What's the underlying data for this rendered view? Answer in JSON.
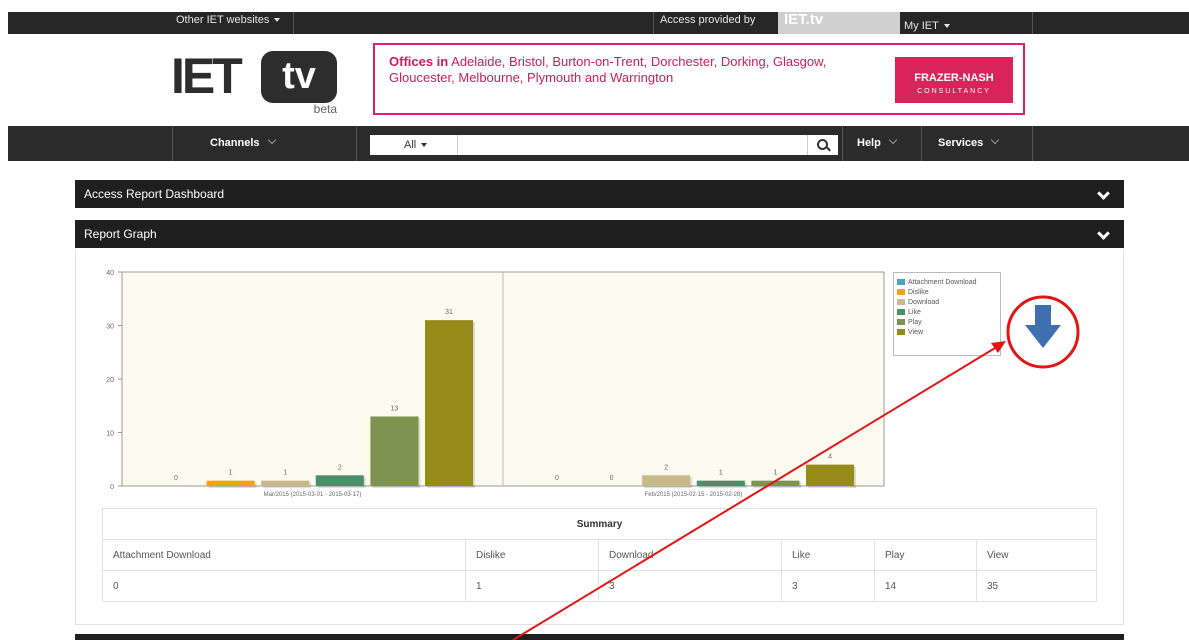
{
  "topbar": {
    "other_sites_label": "Other IET websites",
    "access_provided_label": "Access provided by",
    "access_logo_text": "IET.tv",
    "my_iet_label": "My IET"
  },
  "logo": {
    "text": "IET",
    "tv_text": "tv",
    "badge": "beta"
  },
  "ad": {
    "offices_lead": "Offices in",
    "offices_text": "Adelaide, Bristol, Burton-on-Trent, Dorchester, Dorking, Glasgow, Gloucester, Melbourne, Plymouth and Warrington",
    "brand_name": "FRAZER-NASH",
    "brand_sub": "CONSULTANCY"
  },
  "nav": {
    "channels_label": "Channels",
    "search_scope": "All",
    "search_value": "",
    "help_label": "Help",
    "services_label": "Services"
  },
  "panels": {
    "access_report": "Access Report Dashboard",
    "report_graph": "Report Graph"
  },
  "chart_data": {
    "type": "bar",
    "categories": [
      "Mar/2015 (2015-03-01 - 2015-03-17)",
      "Feb/2015 (2015-02-15 - 2015-02-28)"
    ],
    "series": [
      {
        "name": "Attachment Download",
        "color": "#4aa3c9",
        "values": [
          0,
          0
        ]
      },
      {
        "name": "Dislike",
        "color": "#f2a11a",
        "values": [
          1,
          0
        ]
      },
      {
        "name": "Download",
        "color": "#c8b98a",
        "values": [
          1,
          2
        ]
      },
      {
        "name": "Like",
        "color": "#4a8f6a",
        "values": [
          2,
          1
        ]
      },
      {
        "name": "Play",
        "color": "#7c9450",
        "values": [
          13,
          1
        ]
      },
      {
        "name": "View",
        "color": "#968a18",
        "values": [
          31,
          4
        ]
      }
    ],
    "ylim": [
      0,
      40
    ],
    "yticks": [
      0,
      10,
      20,
      30,
      40
    ],
    "legend": "right",
    "grid": false,
    "plot_background": "#fdfbf0"
  },
  "summary": {
    "title": "Summary",
    "headers": [
      "Attachment Download",
      "Dislike",
      "Download",
      "Like",
      "Play",
      "View"
    ],
    "values": [
      "0",
      "1",
      "3",
      "3",
      "14",
      "35"
    ]
  },
  "annotation": {
    "circle_color": "#e21414",
    "arrow_color": "#e21414",
    "down_arrow_color": "#3f6fb0",
    "down_arrow_icon": "down-arrow-icon"
  }
}
